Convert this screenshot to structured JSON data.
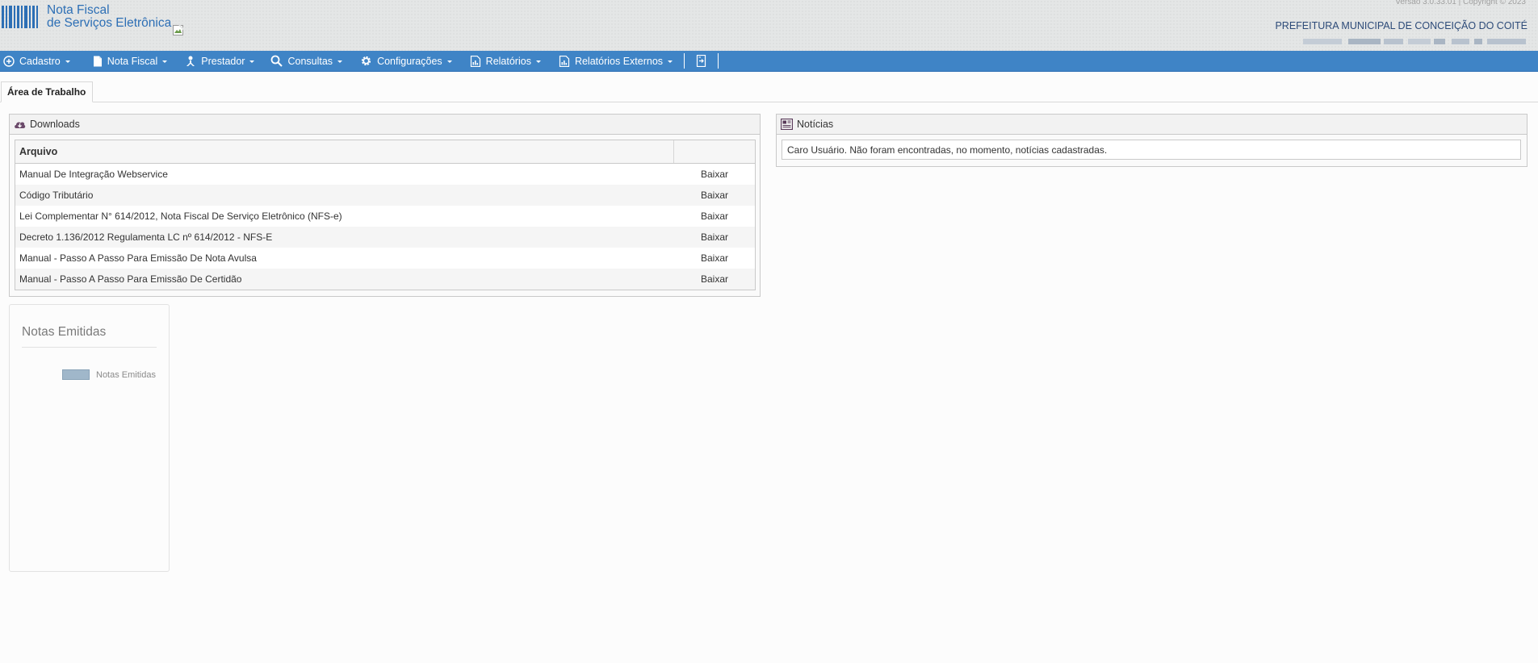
{
  "header": {
    "logo_line1": "Nota Fiscal",
    "logo_line2": "de Serviços Eletrônica",
    "version": "Versão 3.0.33.01 | Copyright © 2023",
    "prefeitura": "PREFEITURA MUNICIPAL DE CONCEIÇÃO DO COITÉ"
  },
  "menu": {
    "items": [
      {
        "label": "Cadastro",
        "icon": "plus-circle-icon"
      },
      {
        "label": "Nota Fiscal",
        "icon": "document-icon"
      },
      {
        "label": "Prestador",
        "icon": "person-icon"
      },
      {
        "label": "Consultas",
        "icon": "search-icon"
      },
      {
        "label": "Configurações",
        "icon": "gear-icon"
      },
      {
        "label": "Relatórios",
        "icon": "report-icon"
      },
      {
        "label": "Relatórios Externos",
        "icon": "report-icon"
      }
    ],
    "exit_icon": "exit-door-icon"
  },
  "tabs": {
    "active": "Área de Trabalho"
  },
  "downloads": {
    "title": "Downloads",
    "column_header": "Arquivo",
    "action_label": "Baixar",
    "rows": [
      {
        "arquivo": "Manual De Integração Webservice",
        "action": "Baixar"
      },
      {
        "arquivo": "Código Tributário",
        "action": "Baixar"
      },
      {
        "arquivo": "Lei Complementar N° 614/2012, Nota Fiscal De Serviço Eletrônico (NFS-e)",
        "action": "Baixar"
      },
      {
        "arquivo": "Decreto 1.136/2012 Regulamenta LC nº 614/2012 - NFS-E",
        "action": "Baixar"
      },
      {
        "arquivo": "Manual - Passo A Passo Para Emissão De Nota Avulsa",
        "action": "Baixar"
      },
      {
        "arquivo": "Manual - Passo A Passo Para Emissão De Certidão",
        "action": "Baixar"
      }
    ]
  },
  "noticias": {
    "title": "Notícias",
    "message": "Caro Usuário. Não foram encontradas, no momento, notícias cadastradas."
  },
  "notas_emitidas": {
    "title": "Notas Emitidas",
    "legend_label": "Notas Emitidas",
    "legend_color": "#a0b7ca"
  },
  "colors": {
    "menu_bg": "#3f84c6",
    "brand_blue": "#2d6fb5",
    "header_bg": "#e4e6e6"
  }
}
